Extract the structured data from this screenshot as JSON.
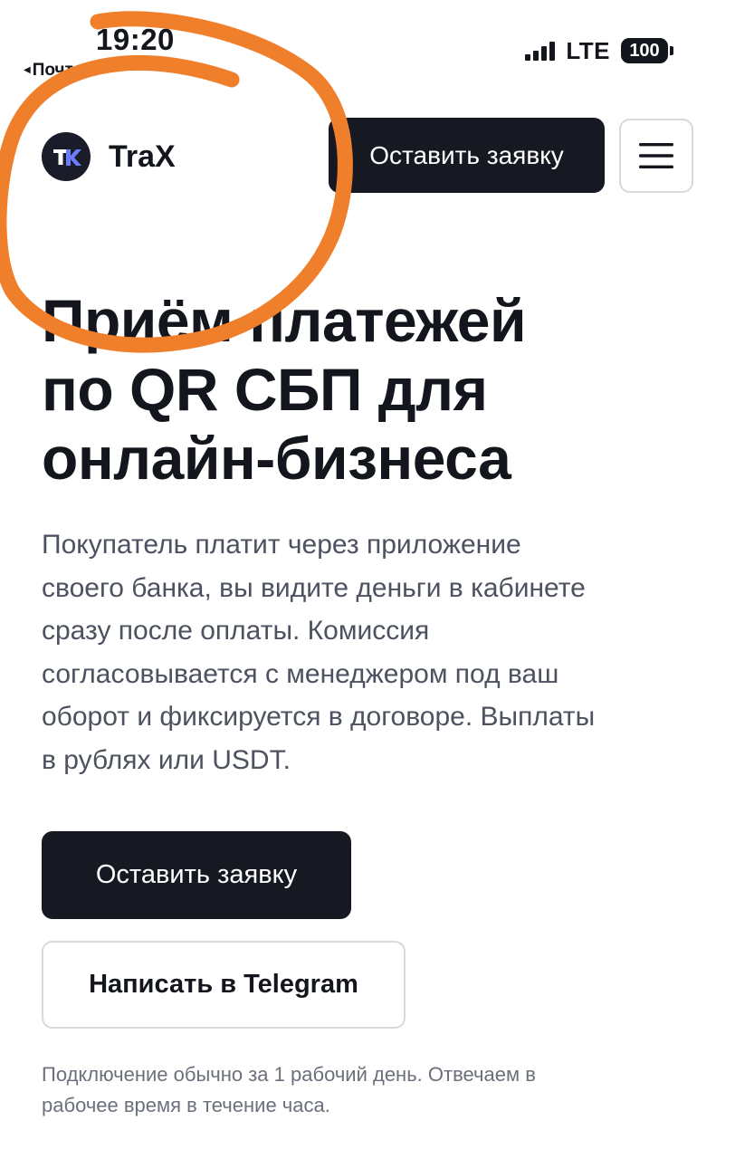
{
  "status_bar": {
    "time": "19:20",
    "back_app": "Почта",
    "network": "LTE",
    "battery": "100"
  },
  "header": {
    "logo_text": "TraX",
    "cta_label": "Оставить заявку"
  },
  "hero": {
    "title_lines": [
      "Приём платежей",
      "по QR СБП для",
      "онлайн-бизнеса"
    ],
    "description_lines": [
      "Покупатель платит через приложение",
      "своего банка, вы видите деньги в кабинете",
      "сразу после оплаты. Комиссия",
      "согласовывается с менеджером под ваш",
      "оборот и фиксируется в договоре. Выплаты",
      "в рублях или USDT."
    ],
    "primary_cta": "Оставить заявку",
    "secondary_cta": "Написать в Telegram",
    "note_lines": [
      "Подключение обычно за 1 рабочий день. Отвечаем в",
      "рабочее время в течение часа."
    ]
  },
  "colors": {
    "dark": "#171922",
    "text_muted": "#4d5260",
    "annotation": "#f07f2c",
    "logo_accent": "#6b7cff"
  },
  "icons": {
    "menu": "hamburger-menu-icon",
    "signal": "cellular-signal-icon",
    "battery": "battery-icon",
    "logo": "trax-logo-icon"
  }
}
